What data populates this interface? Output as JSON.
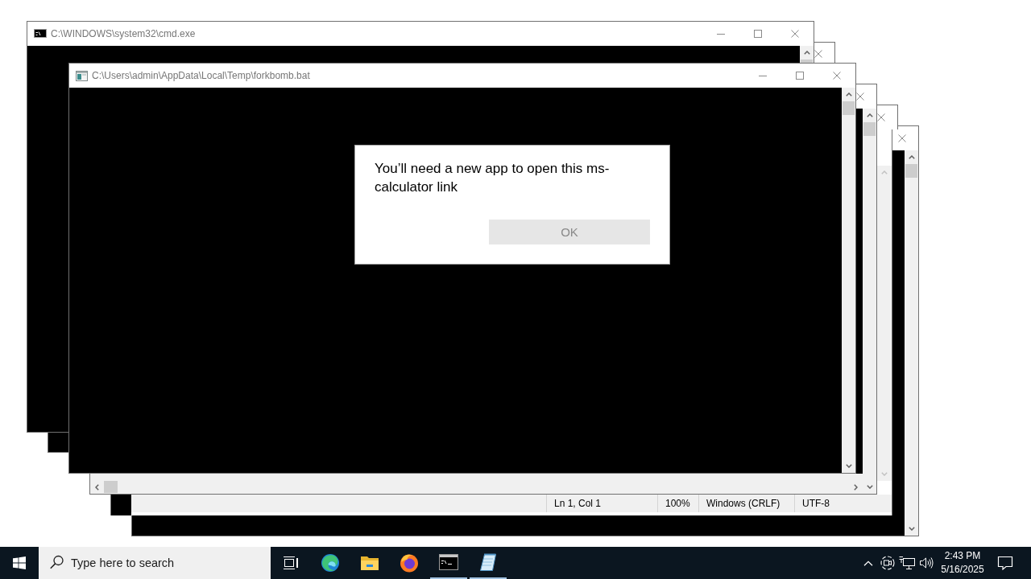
{
  "desktop": {
    "windows": [
      {
        "kind": "console",
        "title": "C:\\WINDOWS\\system32\\cmd.exe",
        "buttons": [
          {
            "kind": "minimize"
          },
          {
            "kind": "maximize"
          },
          {
            "kind": "close"
          }
        ],
        "horizontal_scrollbar": false
      },
      {
        "kind": "console",
        "buttons": [
          {
            "kind": "close"
          }
        ],
        "horizontal_scrollbar": false
      },
      {
        "kind": "batch",
        "title": "C:\\Users\\admin\\AppData\\Local\\Temp\\forkbomb.bat",
        "buttons": [
          {
            "kind": "minimize"
          },
          {
            "kind": "maximize"
          },
          {
            "kind": "close"
          }
        ],
        "horizontal_scrollbar": false
      },
      {
        "kind": "console",
        "buttons": [
          {
            "kind": "close"
          }
        ],
        "horizontal_scrollbar": true
      },
      {
        "kind": "notepad",
        "buttons": [
          {
            "kind": "close"
          }
        ],
        "status_bar": [
          "Ln 1, Col 1",
          "100%",
          "Windows (CRLF)",
          "UTF-8"
        ]
      },
      {
        "kind": "console",
        "buttons": [
          {
            "kind": "close"
          }
        ],
        "horizontal_scrollbar": false
      }
    ]
  },
  "dialog": {
    "message": "You’ll need a new app to open this ms-calculator link",
    "button": "OK"
  },
  "taskbar": {
    "search": {
      "placeholder": "Type here to search"
    },
    "apps": [
      {
        "kind": "task-view",
        "running": false
      },
      {
        "kind": "edge",
        "running": false
      },
      {
        "kind": "explorer",
        "running": false
      },
      {
        "kind": "firefox",
        "running": false
      },
      {
        "kind": "terminal",
        "running": true
      },
      {
        "kind": "notepad",
        "running": true
      }
    ],
    "tray": [
      {
        "kind": "chevron"
      },
      {
        "kind": "meet"
      },
      {
        "kind": "network"
      },
      {
        "kind": "volume"
      }
    ],
    "clock": {
      "time": "2:43 PM",
      "date": "5/16/2025"
    }
  }
}
